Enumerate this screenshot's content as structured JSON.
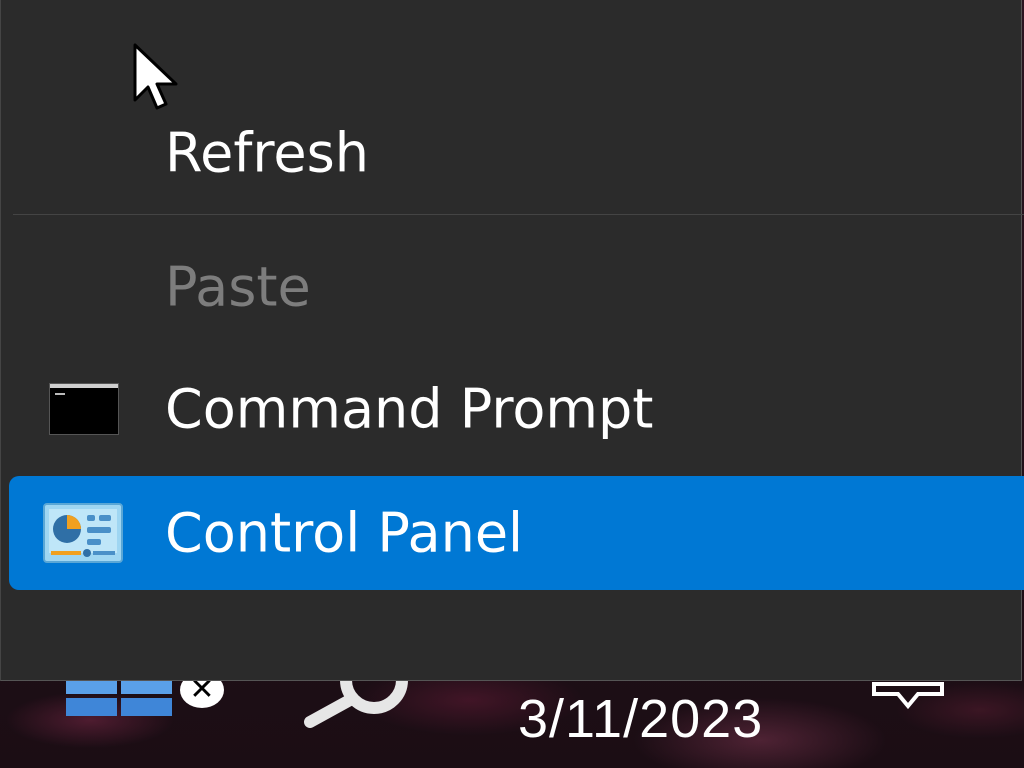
{
  "context_menu": {
    "items": [
      {
        "label": "Refresh",
        "enabled": true
      },
      {
        "label": "Paste",
        "enabled": false
      },
      {
        "label": "Command Prompt",
        "icon": "command-prompt-icon",
        "enabled": true
      },
      {
        "label": "Control Panel",
        "icon": "control-panel-icon",
        "enabled": true,
        "selected": true
      }
    ]
  },
  "taskbar": {
    "clock_date": "3/11/2023",
    "icons": [
      "start-icon",
      "close-badge-icon",
      "search-icon",
      "chat-icon"
    ]
  },
  "colors": {
    "menu_background": "#2b2b2b",
    "selection": "#0078d4",
    "disabled_text": "#7d7d7d"
  }
}
